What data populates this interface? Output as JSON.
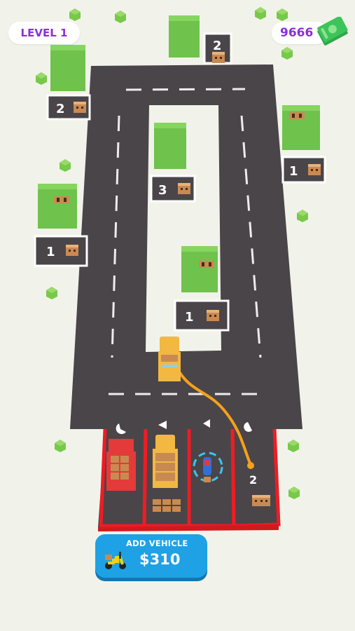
{
  "hud": {
    "level_label": "LEVEL 1",
    "money": "9666"
  },
  "add_vehicle": {
    "label": "ADD VEHICLE",
    "price": "$310"
  },
  "delivery_stops": [
    {
      "name": "stop-top",
      "count": "2"
    },
    {
      "name": "stop-left-upper",
      "count": "2"
    },
    {
      "name": "stop-right",
      "count": "1"
    },
    {
      "name": "stop-center",
      "count": "3"
    },
    {
      "name": "stop-left-lower",
      "count": "1"
    },
    {
      "name": "stop-inner-lower",
      "count": "1"
    }
  ],
  "parking_bays": [
    {
      "name": "bay-1",
      "vehicle": "red-truck",
      "state": "loaded"
    },
    {
      "name": "bay-2",
      "vehicle": "yellow-truck",
      "state": "loaded"
    },
    {
      "name": "bay-3",
      "vehicle": "scooter",
      "state": "selected"
    },
    {
      "name": "bay-4",
      "vehicle": "empty",
      "count": "2"
    }
  ],
  "colors": {
    "road": "#4a4549",
    "grass": "#f1f3ea",
    "block": "#72c64f",
    "bay_border": "#ee1c24",
    "route": "#f5a11c",
    "accent": "#8b2fd6",
    "button": "#1fa1e5"
  }
}
